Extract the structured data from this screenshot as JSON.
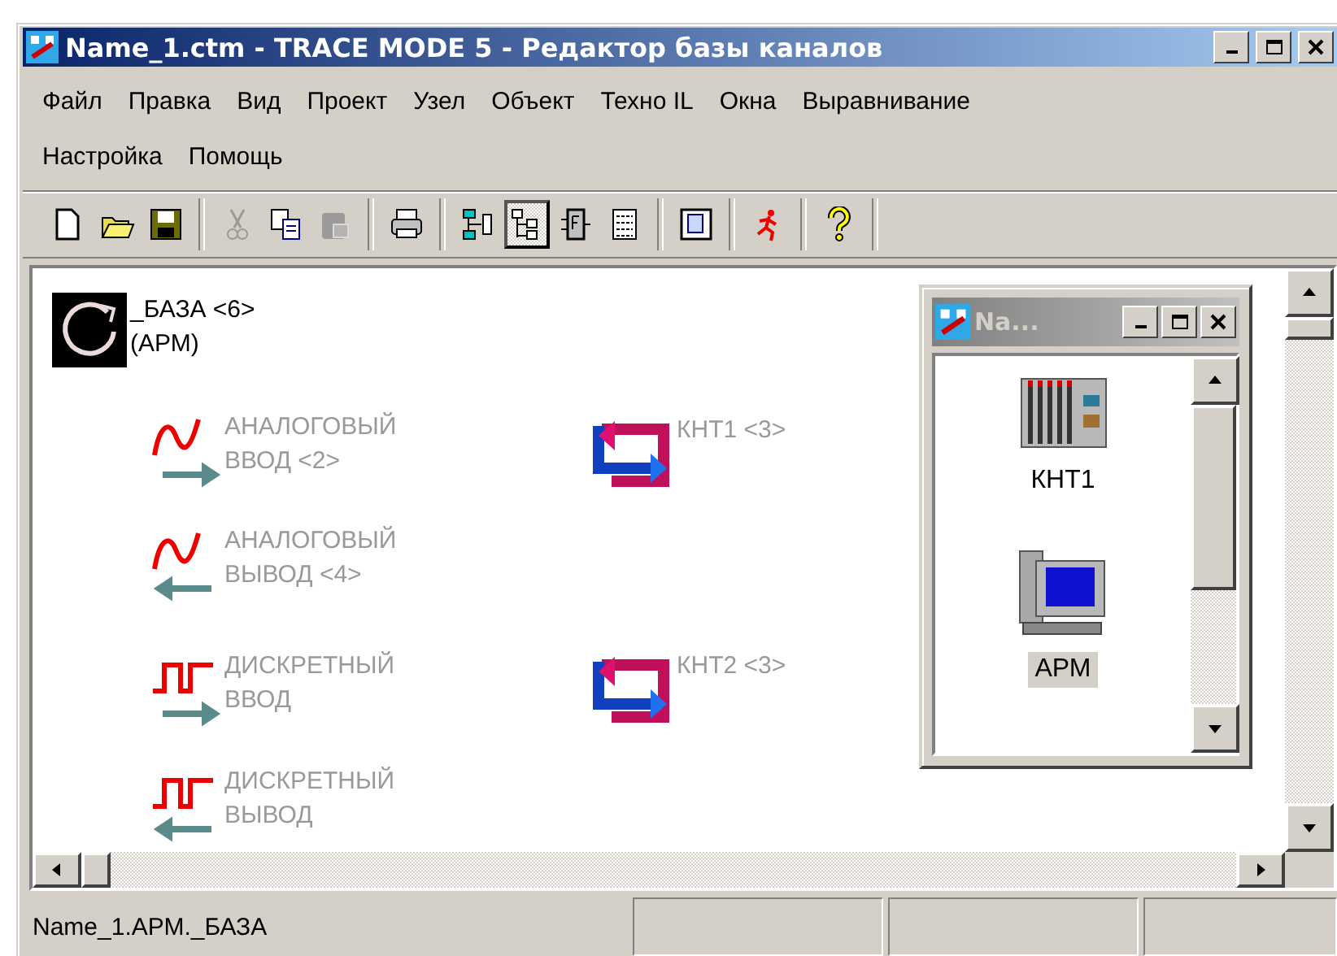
{
  "window": {
    "title": "Name_1.ctm - TRACE MODE 5 - Редактор базы каналов"
  },
  "menu_rows": [
    [
      "Файл",
      "Правка",
      "Вид",
      "Проект",
      "Узел",
      "Объект",
      "Техно IL",
      "Окна",
      "Выравнивание"
    ],
    [
      "Настройка",
      "Помощь"
    ]
  ],
  "toolbar": [
    {
      "kind": "new",
      "pressed": false,
      "disabled": false
    },
    {
      "kind": "open",
      "pressed": false,
      "disabled": false
    },
    {
      "kind": "save",
      "pressed": false,
      "disabled": false
    },
    {
      "kind": "separator"
    },
    {
      "kind": "cut",
      "pressed": false,
      "disabled": true
    },
    {
      "kind": "copy",
      "pressed": false,
      "disabled": false
    },
    {
      "kind": "paste",
      "pressed": false,
      "disabled": true
    },
    {
      "kind": "separator"
    },
    {
      "kind": "print",
      "pressed": false,
      "disabled": false
    },
    {
      "kind": "separator"
    },
    {
      "kind": "network",
      "pressed": false,
      "disabled": false
    },
    {
      "kind": "tree",
      "pressed": true,
      "disabled": false
    },
    {
      "kind": "function",
      "pressed": false,
      "disabled": false
    },
    {
      "kind": "list",
      "pressed": false,
      "disabled": false
    },
    {
      "kind": "separator"
    },
    {
      "kind": "document",
      "pressed": false,
      "disabled": false
    },
    {
      "kind": "separator"
    },
    {
      "kind": "run",
      "pressed": false,
      "disabled": false
    },
    {
      "kind": "separator"
    },
    {
      "kind": "help",
      "pressed": false,
      "disabled": false
    }
  ],
  "canvas": {
    "base": {
      "label": "_БАЗА <6>\n(АРМ)"
    },
    "channels": [
      {
        "kind": "analog_in",
        "label": "АНАЛОГОВЫЙ\nВВОД <2>"
      },
      {
        "kind": "analog_out",
        "label": "АНАЛОГОВЫЙ\nВЫВОД <4>"
      },
      {
        "kind": "discrete_in",
        "label": "ДИСКРЕТНЫЙ\nВВОД"
      },
      {
        "kind": "discrete_out",
        "label": "ДИСКРЕТНЫЙ\nВЫВОД"
      }
    ],
    "links": [
      {
        "label": "КНТ1 <3>"
      },
      {
        "label": "КНТ2 <3>"
      }
    ]
  },
  "child_window": {
    "title": "Na...",
    "items": [
      {
        "kind": "controller",
        "label": "КНТ1",
        "selected": false
      },
      {
        "kind": "computer",
        "label": "АРМ",
        "selected": true
      }
    ]
  },
  "status_bar": {
    "text": "Name_1.АРМ._БАЗА"
  }
}
